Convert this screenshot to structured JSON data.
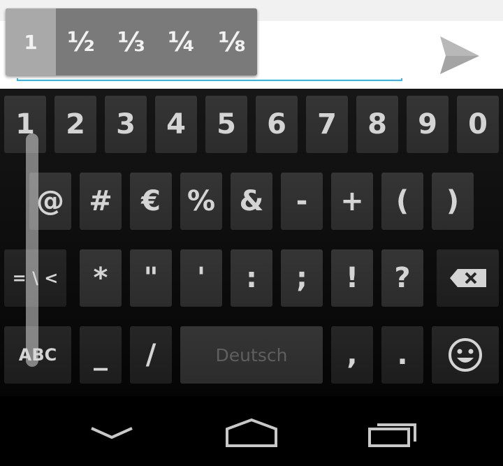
{
  "popup": {
    "items": [
      "1",
      "½",
      "⅓",
      "¼",
      "⅛"
    ],
    "selected_index": 0
  },
  "keyboard": {
    "row1": [
      "1",
      "2",
      "3",
      "4",
      "5",
      "6",
      "7",
      "8",
      "9",
      "0"
    ],
    "row2": [
      "@",
      "#",
      "€",
      "%",
      "&",
      "-",
      "+",
      "(",
      ")"
    ],
    "row3": {
      "more_symbols": "= \\ <",
      "keys": [
        "*",
        "\"",
        "'",
        ":",
        ";",
        "!",
        "?"
      ],
      "delete_icon": "backspace-icon"
    },
    "row4": {
      "abc": "ABC",
      "underscore": "_",
      "slash": "/",
      "space": "Deutsch",
      "comma": ",",
      "period": ".",
      "emoji_icon": "smiley-icon"
    }
  },
  "nav": {
    "back_icon": "back-chevron-icon",
    "home_icon": "home-icon",
    "recents_icon": "recents-icon"
  },
  "colors": {
    "accent": "#33b5e5",
    "key_bg": "#353535",
    "key_text": "#d4d4d4",
    "popup_bg": "#7a7a7a",
    "popup_selected": "#a9a9a9"
  }
}
